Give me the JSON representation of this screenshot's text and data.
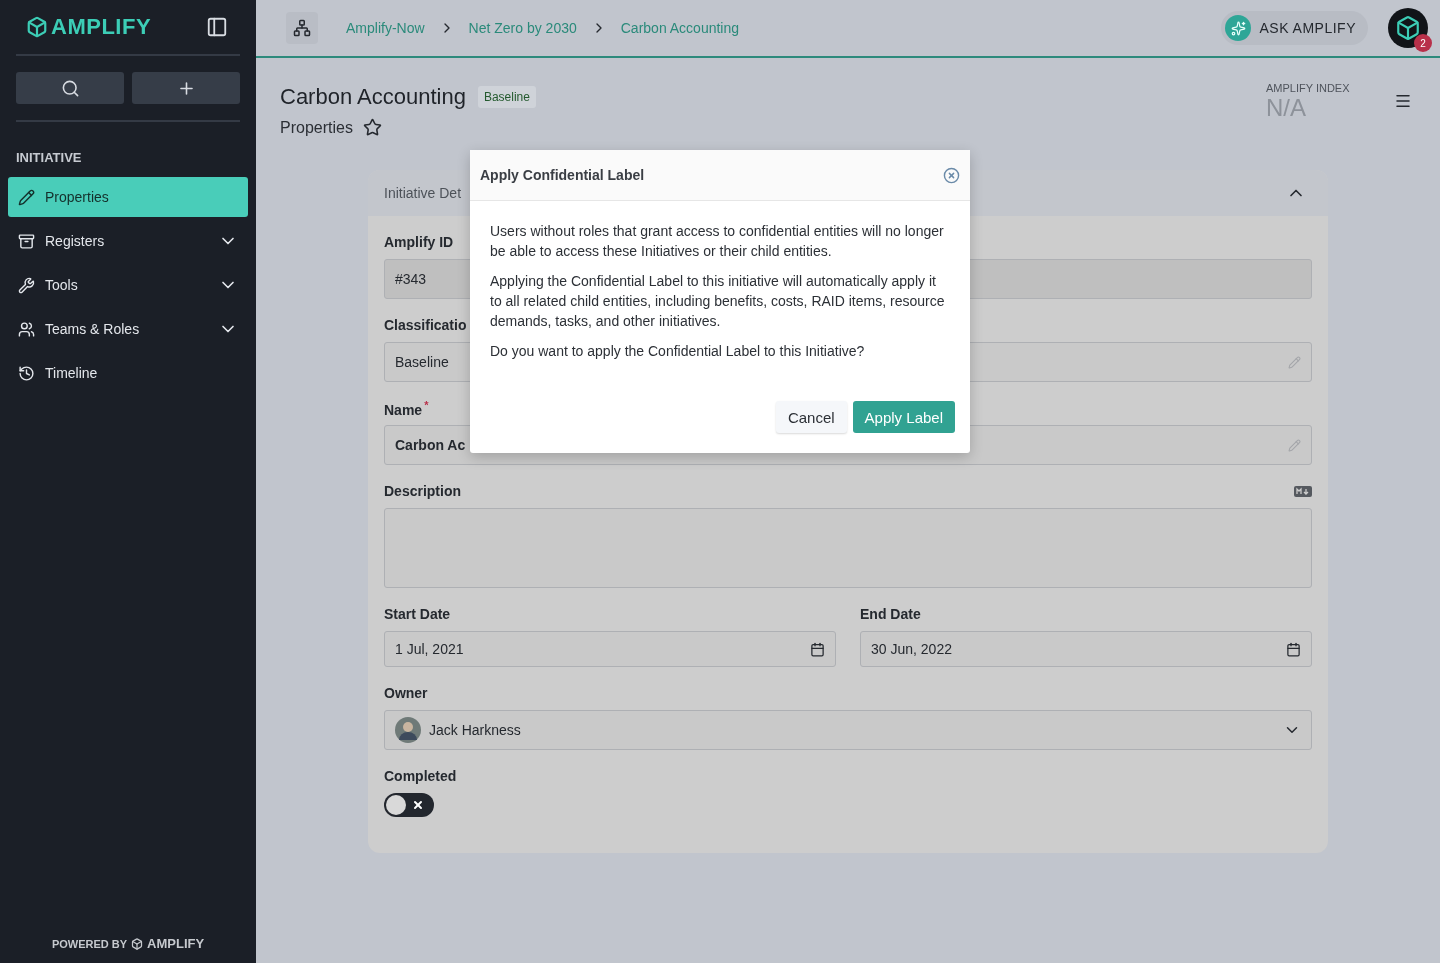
{
  "sidebar": {
    "logo": "AMPLIFY",
    "section": "INITIATIVE",
    "items": [
      {
        "label": "Properties",
        "selected": true,
        "expandable": false
      },
      {
        "label": "Registers",
        "selected": false,
        "expandable": true
      },
      {
        "label": "Tools",
        "selected": false,
        "expandable": true
      },
      {
        "label": "Teams & Roles",
        "selected": false,
        "expandable": true
      },
      {
        "label": "Timeline",
        "selected": false,
        "expandable": false
      }
    ],
    "footer_prefix": "POWERED BY",
    "footer_logo": "AMPLIFY"
  },
  "breadcrumbs": [
    "Amplify-Now",
    "Net Zero by 2030",
    "Carbon Accounting"
  ],
  "ask_button": "ASK AMPLIFY",
  "notification_count": "2",
  "page": {
    "title": "Carbon Accounting",
    "badge": "Baseline",
    "subtitle": "Properties",
    "favorite": false,
    "index_label": "AMPLIFY INDEX",
    "index_value": "N/A"
  },
  "card": {
    "title": "Initiative Det",
    "expanded": true,
    "fields": [
      {
        "kind": "text",
        "label": "Amplify ID",
        "value": "#343",
        "editable": false
      },
      {
        "kind": "text",
        "label": "Classificatio",
        "value": "Baseline",
        "editable": true
      },
      {
        "kind": "text",
        "label": "Name",
        "required_mark": "*",
        "value": "Carbon Ac",
        "bold": true,
        "editable": true
      },
      {
        "kind": "textarea",
        "label": "Description"
      },
      {
        "kind": "dates",
        "items": [
          {
            "label": "Start Date",
            "value": "1 Jul, 2021"
          },
          {
            "label": "End Date",
            "value": "30 Jun, 2022"
          }
        ]
      },
      {
        "kind": "select",
        "label": "Owner",
        "value": "Jack Harkness"
      },
      {
        "kind": "toggle",
        "label": "Completed",
        "on": false
      }
    ]
  },
  "dialog": {
    "title": "Apply Confidential Label",
    "paragraphs": [
      "Users without roles that grant access to confidential entities will no longer be able to access these Initiatives or their child entities.",
      "Applying the Confidential Label to this initiative will automatically apply it to all related child entities, including benefits, costs, RAID items, resource demands, tasks, and other initiatives.",
      "Do you want to apply the Confidential Label to this Initiative?"
    ],
    "buttons": [
      {
        "label": "Cancel",
        "kind": "secondary"
      },
      {
        "label": "Apply Label",
        "kind": "primary"
      }
    ]
  }
}
